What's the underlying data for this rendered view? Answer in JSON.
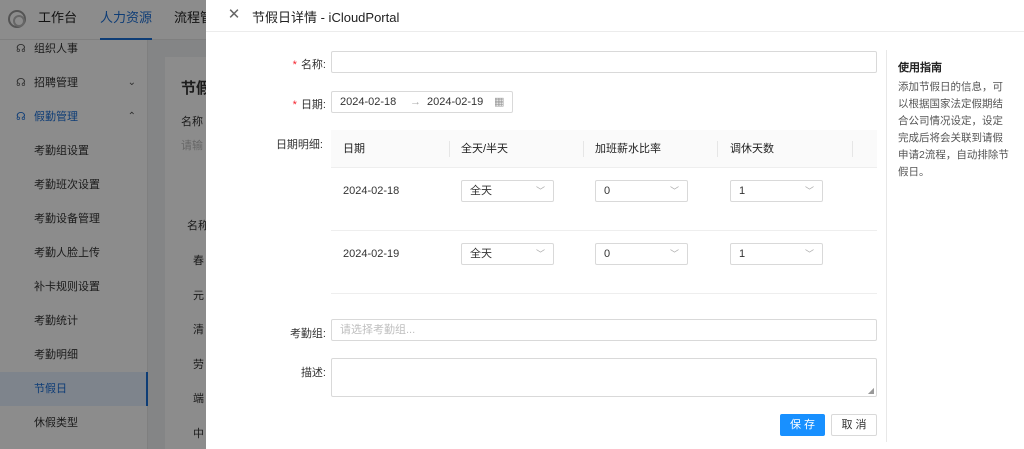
{
  "topbar": {
    "nav": [
      "工作台",
      "人力资源",
      "流程管"
    ]
  },
  "sidebar": {
    "groups": [
      {
        "label": "组织人事",
        "icon": "people-icon"
      },
      {
        "label": "招聘管理",
        "icon": "people-icon",
        "chevron": "⌄"
      },
      {
        "label": "假勤管理",
        "icon": "people-icon",
        "chevron": "⌃"
      }
    ],
    "items": [
      "考勤组设置",
      "考勤班次设置",
      "考勤设备管理",
      "考勤人脸上传",
      "补卡规则设置",
      "考勤统计",
      "考勤明细",
      "节假日",
      "休假类型"
    ],
    "active": "节假日"
  },
  "background": {
    "page_title": "节假",
    "filter_label": "名称",
    "filter_placeholder": "请输",
    "col_header": "名称",
    "rows": [
      "春",
      "元",
      "清",
      "劳",
      "端",
      "中"
    ]
  },
  "drawer": {
    "title": "节假日详情 - iCloudPortal",
    "form": {
      "name_label": "名称:",
      "name_value": "",
      "date_label": "日期:",
      "date_start": "2024-02-18",
      "date_end": "2024-02-19",
      "date_sep": "→",
      "detail_label": "日期明细:",
      "group_label": "考勤组:",
      "group_placeholder": "请选择考勤组...",
      "desc_label": "描述:"
    },
    "table": {
      "headers": [
        "日期",
        "全天/半天",
        "加班薪水比率",
        "调休天数"
      ],
      "rows": [
        {
          "date": "2024-02-18",
          "day_type": "全天",
          "overtime_rate": "0",
          "comp_days": "1"
        },
        {
          "date": "2024-02-19",
          "day_type": "全天",
          "overtime_rate": "0",
          "comp_days": "1"
        }
      ]
    },
    "buttons": {
      "save": "保 存",
      "cancel": "取 消"
    },
    "guide": {
      "title": "使用指南",
      "text": "添加节假日的信息，可以根据国家法定假期结合公司情况设定，设定完成后将会关联到请假申请2流程，自动排除节假日。"
    }
  },
  "colors": {
    "primary": "#1890ff",
    "required": "#f5222d",
    "nav_active": "#1b6fd8"
  }
}
